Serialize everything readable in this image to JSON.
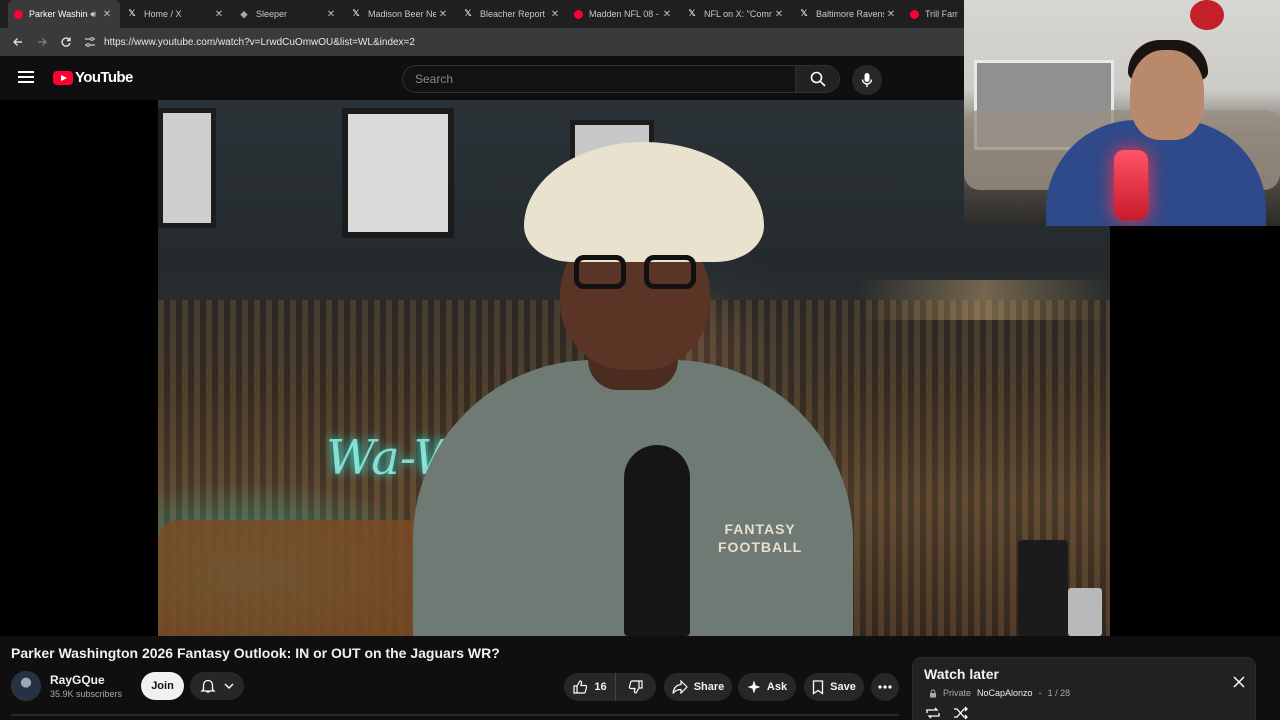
{
  "browser": {
    "tabs": [
      {
        "title": "Parker Washin",
        "favicon": "youtube-icon",
        "active": true,
        "audio": true
      },
      {
        "title": "Home / X",
        "favicon": "x-icon"
      },
      {
        "title": "Sleeper",
        "favicon": "sleeper-icon"
      },
      {
        "title": "Madison Beer Nev",
        "favicon": "x-icon"
      },
      {
        "title": "Bleacher Report o",
        "favicon": "x-icon"
      },
      {
        "title": "Madden NFL 08 -",
        "favicon": "youtube-icon"
      },
      {
        "title": "NFL on X: \"Comm",
        "favicon": "x-icon"
      },
      {
        "title": "Baltimore Ravens",
        "favicon": "x-icon"
      },
      {
        "title": "Trill Famil",
        "favicon": "youtube-icon"
      }
    ],
    "close_glyph": "✕",
    "url": "https://www.youtube.com/watch?v=LrwdCuOmwOU&list=WL&index=2"
  },
  "youtube": {
    "logo_text": "YouTube",
    "search_placeholder": "Search"
  },
  "video": {
    "title": "Parker Washington 2026 Fantasy Outlook: IN or OUT on the Jaguars WR?",
    "channel": "RayGQue",
    "subscribers": "35.9K subscribers",
    "join_label": "Join",
    "like_count": "16",
    "share_label": "Share",
    "ask_label": "Ask",
    "save_label": "Save",
    "neon_sign": "Wa-W",
    "shirt_logo": "FANTASY\nFOOTBALL"
  },
  "playlist": {
    "title": "Watch later",
    "privacy": "Private",
    "owner": "NoCapAlonzo",
    "position": "1 / 28"
  },
  "colors": {
    "brand_red": "#ff0033",
    "background": "#0f0f0f",
    "pill": "#272727"
  }
}
